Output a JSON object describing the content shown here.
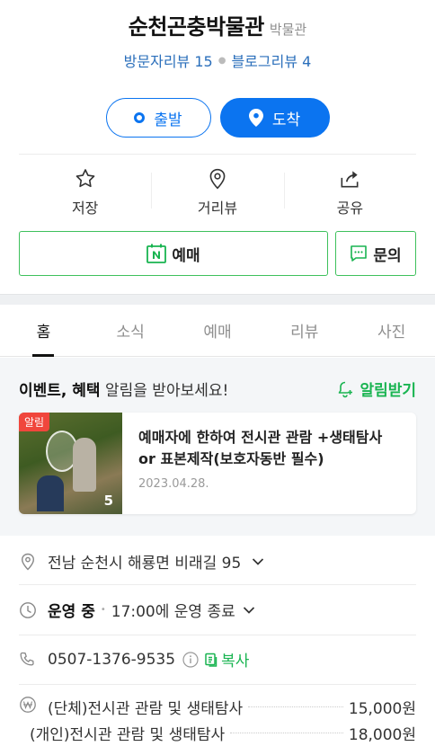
{
  "place": {
    "name": "순천곤충박물관",
    "category": "박물관",
    "visitor_reviews": "방문자리뷰 15",
    "blog_reviews": "블로그리뷰 4"
  },
  "route": {
    "depart_label": "출발",
    "arrive_label": "도착"
  },
  "actions": {
    "save_label": "저장",
    "streetview_label": "거리뷰",
    "share_label": "공유"
  },
  "buttons": {
    "reserve_label": "예매",
    "inquiry_label": "문의"
  },
  "tabs": [
    {
      "label": "홈",
      "active": true
    },
    {
      "label": "소식",
      "active": false
    },
    {
      "label": "예매",
      "active": false
    },
    {
      "label": "리뷰",
      "active": false
    },
    {
      "label": "사진",
      "active": false
    }
  ],
  "event": {
    "heading_bold": "이벤트, 혜택",
    "heading_rest": " 알림을 받아보세요!",
    "subscribe_label": "알림받기",
    "badge": "알림",
    "image_count": "5",
    "title": "예매자에 한하여 전시관 관람 +생태탐사 or 표본제작(보호자동반 필수)",
    "date": "2023.04.28."
  },
  "info": {
    "address": "전남 순천시 해룡면 비래길 95",
    "status": "운영 중",
    "hours": "17:00에 운영 종료",
    "phone": "0507-1376-9535",
    "copy_label": "복사",
    "prices": [
      {
        "name": "(단체)전시관 관람 및 생태탐사",
        "price": "15,000원"
      },
      {
        "name": "(개인)전시관 관람 및 생태탐사",
        "price": "18,000원"
      }
    ]
  },
  "colors": {
    "accent_blue": "#0b74f0",
    "naver_green": "#19b451",
    "badge_red": "#f0463c"
  }
}
